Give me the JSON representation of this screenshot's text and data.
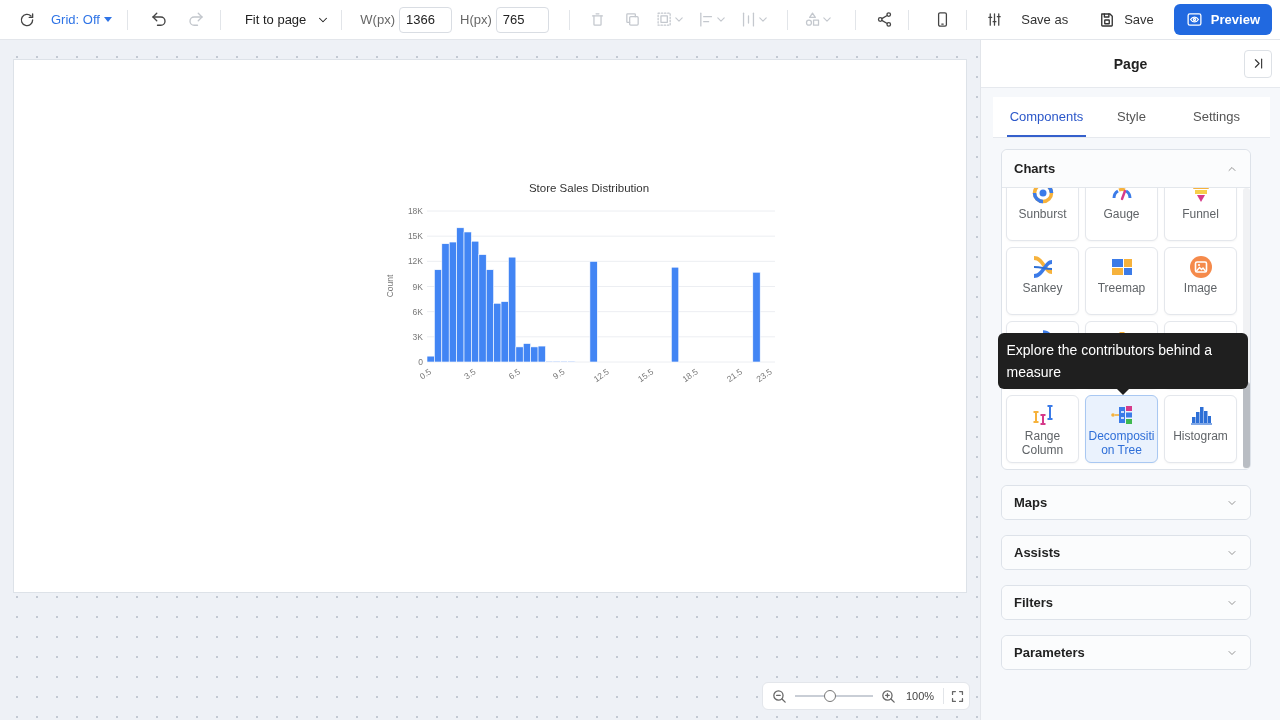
{
  "toolbar": {
    "grid_menu": {
      "label": "Grid: Off"
    },
    "history": [
      {
        "disabled": false
      },
      {
        "disabled": true
      }
    ],
    "zoom_select": {
      "value": "Fit to page"
    },
    "size_fields": [
      {
        "label": "W(px)",
        "value": "1366"
      },
      {
        "label": "H(px)",
        "value": "765"
      }
    ],
    "tool_groups": [
      [
        {
          "disabled": true,
          "dropdown": false
        },
        {
          "disabled": true,
          "dropdown": false
        },
        {
          "disabled": true,
          "dropdown": true
        },
        {
          "disabled": true,
          "dropdown": true
        },
        {
          "disabled": true,
          "dropdown": true
        }
      ],
      [
        {
          "disabled": true,
          "dropdown": true
        }
      ],
      [
        {
          "disabled": false,
          "dropdown": false
        }
      ],
      [
        {
          "disabled": false,
          "dropdown": false
        }
      ],
      [
        {
          "disabled": false,
          "dropdown": false
        }
      ]
    ],
    "actions": [
      {
        "label": "Save as",
        "kind": "text"
      },
      {
        "label": "Save",
        "kind": "save"
      },
      {
        "label": "Preview",
        "kind": "primary"
      }
    ]
  },
  "canvas": {
    "chart_data": {
      "type": "bar",
      "title": "Store Sales Distribution",
      "ylabel": "Count",
      "grid": true,
      "x": [
        0.75,
        1.25,
        1.75,
        2.25,
        2.75,
        3.25,
        3.75,
        4.25,
        4.75,
        5.25,
        5.75,
        6.25,
        6.75,
        7.25,
        7.75,
        8.25,
        8.75,
        9.25,
        9.75,
        10.25,
        11.75,
        17.25,
        22.75
      ],
      "values": [
        700,
        11000,
        14100,
        14300,
        16000,
        15500,
        14400,
        12800,
        11000,
        7000,
        7200,
        12500,
        1800,
        2200,
        1800,
        1900,
        100,
        100,
        100,
        100,
        12000,
        11300,
        10700
      ],
      "xlim": [
        0.5,
        24
      ],
      "ylim": [
        0,
        18000
      ],
      "xticks": [
        0.5,
        3.5,
        6.5,
        9.5,
        12.5,
        15.5,
        18.5,
        21.5,
        23.5
      ],
      "yticks": [
        {
          "value": 0,
          "label": "0"
        },
        {
          "value": 3000,
          "label": "3K"
        },
        {
          "value": 6000,
          "label": "6K"
        },
        {
          "value": 9000,
          "label": "9K"
        },
        {
          "value": 12000,
          "label": "12K"
        },
        {
          "value": 15000,
          "label": "15K"
        },
        {
          "value": 18000,
          "label": "18K"
        }
      ]
    },
    "zoom_control": {
      "level": 0.45,
      "value": "100%"
    }
  },
  "panel": {
    "title": "Page",
    "tabs": [
      {
        "label": "Components",
        "selected": true
      },
      {
        "label": "Style",
        "selected": false
      },
      {
        "label": "Settings",
        "selected": false
      }
    ],
    "sections": [
      {
        "title": "Charts",
        "expanded": true,
        "tiles": [
          {
            "label": "Sunburst",
            "selected": false
          },
          {
            "label": "Gauge",
            "selected": false
          },
          {
            "label": "Funnel",
            "selected": false
          },
          {
            "label": "Sankey",
            "selected": false
          },
          {
            "label": "Treemap",
            "selected": false
          },
          {
            "label": "Image",
            "selected": false
          },
          {
            "selected": false
          },
          {
            "selected": false
          },
          {
            "selected": false
          },
          {
            "label": "Range Column",
            "selected": false
          },
          {
            "label": "Decomposition Tree",
            "selected": true,
            "tooltip": "Explore the contributors behind a measure"
          },
          {
            "label": "Histogram",
            "selected": false
          }
        ]
      },
      {
        "title": "Maps",
        "expanded": false
      },
      {
        "title": "Assists",
        "expanded": false
      },
      {
        "title": "Filters",
        "expanded": false
      },
      {
        "title": "Parameters",
        "expanded": false
      }
    ]
  }
}
